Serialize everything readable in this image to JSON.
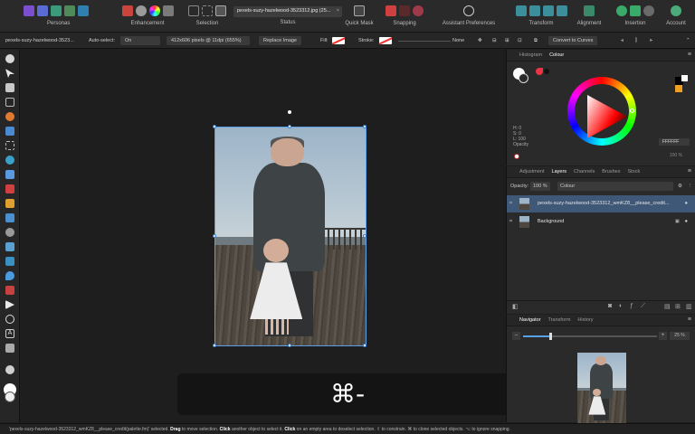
{
  "toolbar": {
    "groups": {
      "personas": "Personas",
      "enhancement": "Enhancement",
      "selection": "Selection",
      "status": "Status",
      "quick_mask": "Quick Mask",
      "snapping": "Snapping",
      "assistant": "Assistant Preferences",
      "transform": "Transform",
      "alignment": "Alignment",
      "insertion": "Insertion",
      "account": "Account"
    },
    "document_tab": "pexels-suzy-hazelwood-3523312.jpg (25...",
    "document_tab_close": "×"
  },
  "context": {
    "layer_name": "pexels-suzy-hazelwood-3523...",
    "auto_select_label": "Auto-select:",
    "auto_select_value": "On",
    "image_info": "412x606 pixels @ 11dpi (655%)",
    "replace_image": "Replace Image",
    "fill_label": "Fill:",
    "stroke_label": "Stroke:",
    "stroke_value": "None",
    "convert_to_curves": "Convert to Curves"
  },
  "shortcut": {
    "keys": "⌘-"
  },
  "colour_panel": {
    "tabs": [
      "Histogram",
      "Colour"
    ],
    "active_tab": "Colour",
    "h": "H: 0",
    "s": "S: 0",
    "l": "L: 100",
    "opacity_label": "Opacity",
    "hex": "FFFFFF",
    "opacity_value": "100 %"
  },
  "layers_panel": {
    "tabs": [
      "Adjustment",
      "Layers",
      "Channels",
      "Brushes",
      "Stock"
    ],
    "active_tab": "Layers",
    "opacity_label": "Opacity:",
    "opacity_value": "100 %",
    "blend_mode": "Colour",
    "layers": [
      {
        "name": "pexels-suzy-hazelwood-3523312_wmKZ8__please_credit...",
        "selected": true
      },
      {
        "name": "Background",
        "selected": false
      }
    ]
  },
  "navigator_panel": {
    "tabs": [
      "Navigator",
      "Transform",
      "History"
    ],
    "active_tab": "Navigator",
    "zoom_minus": "–",
    "zoom_plus": "+",
    "zoom_value": "25 %",
    "zoom_slider_level": 0.2
  },
  "status_bar": {
    "selection_info": "'pexels-suzy-hazelwood-3523312_wmKZ8__please_credit(palette.fm)' selected. ",
    "drag": "Drag",
    "drag_text": " to move selection. ",
    "click1": "Click",
    "click1_text": " another object to select it. ",
    "click2": "Click",
    "click2_text": " on an empty area to deselect selection. ",
    "shift_text": "⇧ to constrain. ",
    "cmd_text": "⌘ to clone selected objects. ",
    "opt_text": "⌥ to ignore snapping."
  },
  "colors": {
    "accent": "#5aa0e6",
    "selected_layer": "#3f5877",
    "panel_bg": "#2a2a2a",
    "canvas_bg": "#1e1e1e"
  }
}
